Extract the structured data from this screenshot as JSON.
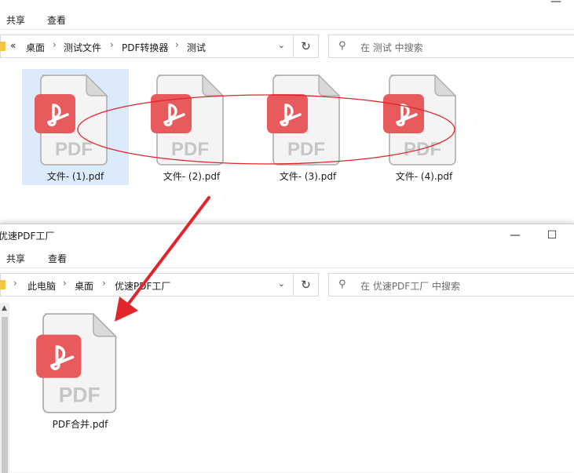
{
  "window1": {
    "title_fragment": "...",
    "ribbon": {
      "share": "共享",
      "view": "查看"
    },
    "breadcrumb": {
      "chevrons": "«",
      "items": [
        "桌面",
        "测试文件",
        "PDF转换器",
        "测试"
      ]
    },
    "search_placeholder": "在 测试 中搜索",
    "files": [
      "文件- (1).pdf",
      "文件- (2).pdf",
      "文件- (3).pdf",
      "文件- (4).pdf"
    ]
  },
  "window2": {
    "title": "优速PDF工厂",
    "ribbon": {
      "share": "共享",
      "view": "查看"
    },
    "breadcrumb": {
      "items": [
        "此电脑",
        "桌面",
        "优速PDF工厂"
      ]
    },
    "search_placeholder": "在 优速PDF工厂 中搜索",
    "files": [
      "PDF合并.pdf"
    ]
  },
  "icons": {
    "pdf_badge_color": "#e95a5d",
    "pdf_text": "PDF",
    "annotation_color": "#e0262b"
  }
}
